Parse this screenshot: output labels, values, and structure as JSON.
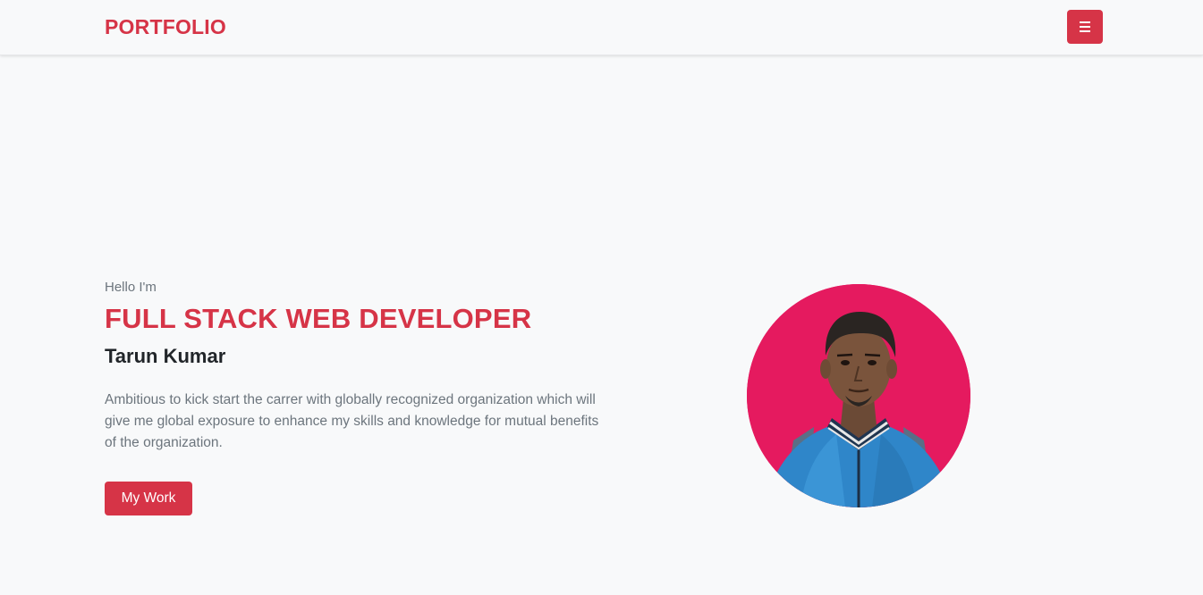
{
  "navbar": {
    "brand": "PORTFOLIO",
    "menu_icon": "hamburger-icon"
  },
  "hero": {
    "greeting": "Hello I'm",
    "role": "FULL STACK WEB DEVELOPER",
    "name": "Tarun Kumar",
    "description": "Ambitious to kick start the carrer with globally recognized organization which will give me global exposure to enhance my skills and knowledge for mutual benefits of the organization.",
    "cta_label": "My Work",
    "avatar_alt": "profile-photo"
  },
  "colors": {
    "accent": "#d63447",
    "avatar_background": "#e51a5f",
    "page_background": "#f8f9fa",
    "text_dark": "#212529",
    "text_muted": "#6c757d"
  }
}
